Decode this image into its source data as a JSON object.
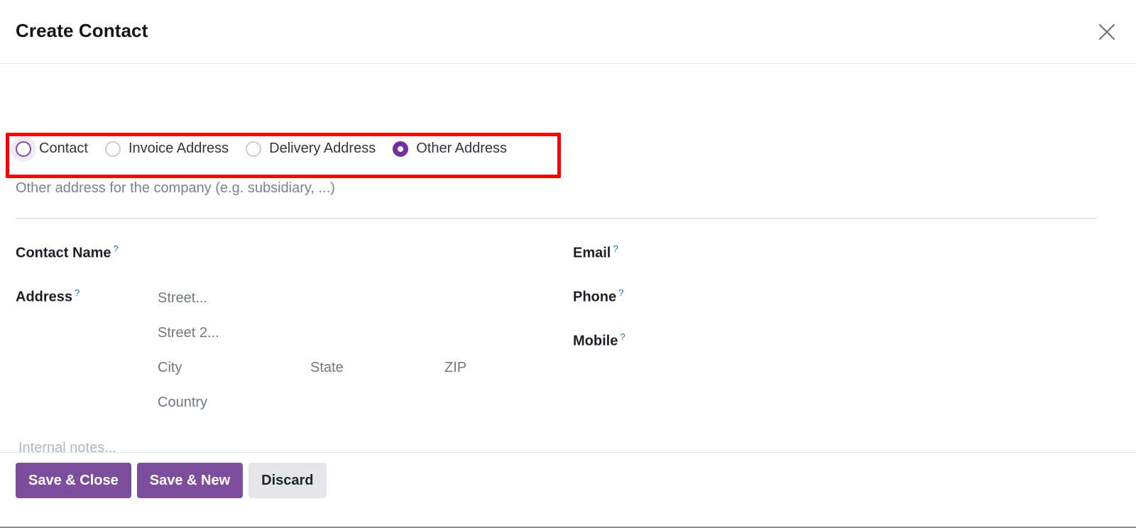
{
  "dialog": {
    "title": "Create Contact",
    "close_icon": "close-icon"
  },
  "address_type": {
    "selected": "Other Address",
    "description": "Other address for the company (e.g. subsidiary, ...)",
    "options": [
      {
        "label": "Contact",
        "checked": false,
        "focused": true
      },
      {
        "label": "Invoice Address",
        "checked": false,
        "focused": false
      },
      {
        "label": "Delivery Address",
        "checked": false,
        "focused": false
      },
      {
        "label": "Other Address",
        "checked": true,
        "focused": false
      }
    ]
  },
  "form": {
    "help_marker": "?",
    "left": {
      "contact_name_label": "Contact Name",
      "contact_name_value": "",
      "address_label": "Address",
      "street_placeholder": "Street...",
      "street2_placeholder": "Street 2...",
      "city_placeholder": "City",
      "state_placeholder": "State",
      "zip_placeholder": "ZIP",
      "country_placeholder": "Country"
    },
    "right": {
      "email_label": "Email",
      "email_value": "",
      "phone_label": "Phone",
      "phone_value": "",
      "mobile_label": "Mobile",
      "mobile_value": ""
    },
    "notes_placeholder": "Internal notes..."
  },
  "footer": {
    "save_close_label": "Save & Close",
    "save_new_label": "Save & New",
    "discard_label": "Discard"
  },
  "colors": {
    "primary": "#7d4e9b",
    "radio_selected": "#71309c",
    "highlight_box": "#fe0000",
    "help_marker": "#1a73a8",
    "placeholder": "#72787f"
  }
}
